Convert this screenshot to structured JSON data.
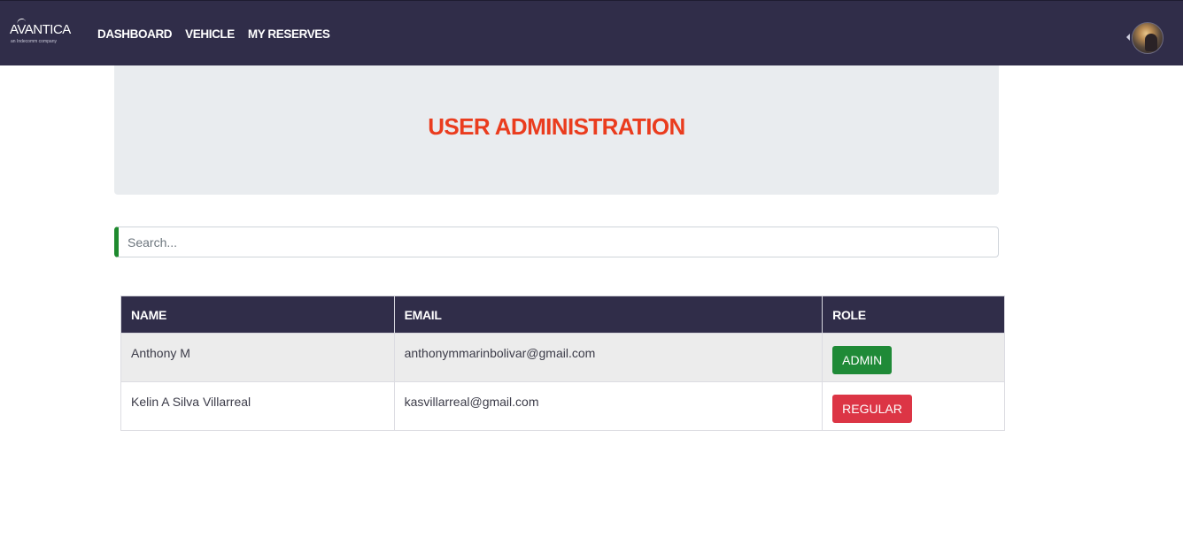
{
  "brand": {
    "name": "AVANTICA",
    "tagline": "an Indecomm company"
  },
  "nav": {
    "items": [
      {
        "label": "DASHBOARD"
      },
      {
        "label": "VEHICLE"
      },
      {
        "label": "MY RESERVES"
      }
    ]
  },
  "header": {
    "title": "USER ADMINISTRATION"
  },
  "search": {
    "placeholder": "Search...",
    "value": ""
  },
  "table": {
    "columns": [
      "NAME",
      "EMAIL",
      "ROLE"
    ],
    "rows": [
      {
        "name": "Anthony M",
        "email": "anthonymmarinbolivar@gmail.com",
        "role": "ADMIN"
      },
      {
        "name": "Kelin A Silva Villarreal",
        "email": "kasvillarreal@gmail.com",
        "role": "REGULAR"
      }
    ]
  },
  "colors": {
    "navbar": "#302d49",
    "title": "#ea3c1e",
    "admin": "#1f8a37",
    "regular": "#dc3545",
    "search_accent": "#1e8a2e"
  },
  "icons": {
    "avatar": "user-avatar-photo",
    "caret": "caret-left-icon"
  }
}
